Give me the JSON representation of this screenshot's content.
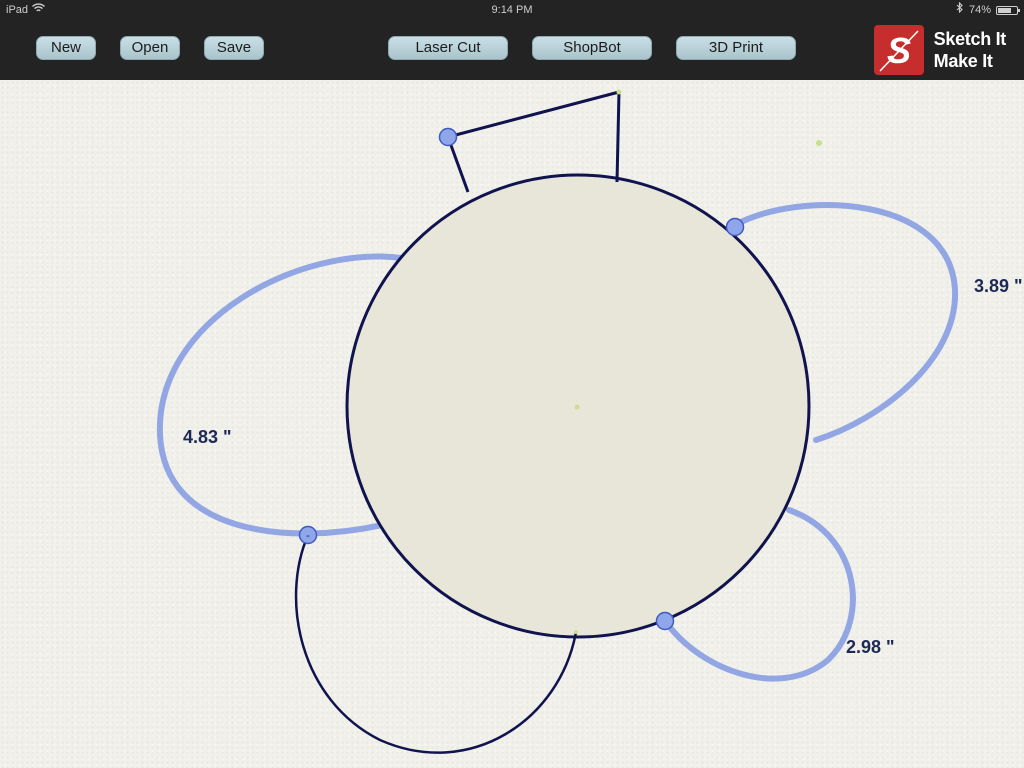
{
  "status_bar": {
    "device": "iPad",
    "time": "9:14 PM",
    "battery": "74%",
    "battery_level": 0.74
  },
  "toolbar": {
    "new_label": "New",
    "open_label": "Open",
    "save_label": "Save",
    "laser_cut_label": "Laser Cut",
    "shopbot_label": "ShopBot",
    "print_3d_label": "3D Print"
  },
  "logo": {
    "line1": "Sketch It",
    "line2": "Make It",
    "mark_letter": "S"
  },
  "dimensions": {
    "left_arc": "4.83 \"",
    "right_arc": "3.89 \"",
    "bottom_right_arc": "2.98 \""
  },
  "handles": {
    "bottom_left_symbol": "-"
  },
  "colors": {
    "stroke": "#10134e",
    "fill": "#e8e6d9",
    "arc": "#93a6e4",
    "handle_fill": "#8fa6ea",
    "handle_stroke": "#3f5bbd",
    "point": "#c8e08a",
    "toolbar_bg": "#232323",
    "button_bg": "#b8d2da",
    "logo_red": "#c62d2d"
  }
}
